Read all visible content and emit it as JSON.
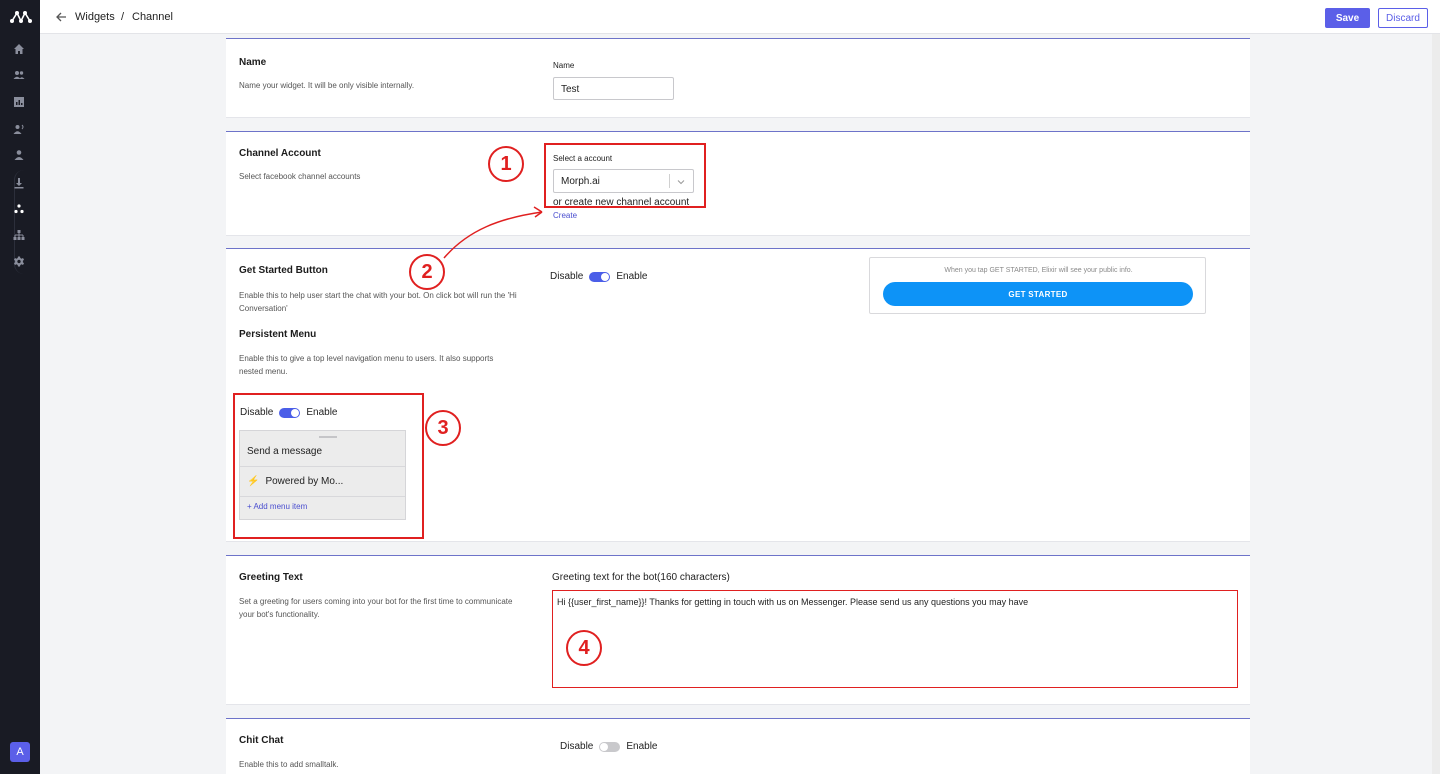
{
  "sidebar": {
    "logo": "morph-logo-icon",
    "items": [
      {
        "icon": "home-icon"
      },
      {
        "icon": "users-group-icon"
      },
      {
        "icon": "analytics-icon"
      },
      {
        "icon": "broadcast-user-icon"
      },
      {
        "icon": "user-icon"
      },
      {
        "icon": "download-icon"
      },
      {
        "icon": "widgets-icon",
        "active": true
      },
      {
        "icon": "hierarchy-icon"
      },
      {
        "icon": "settings-icon"
      }
    ],
    "avatar_initial": "A",
    "avatar_color": "#5b5fe8"
  },
  "topbar": {
    "breadcrumb": {
      "parent": "Widgets",
      "separator": "/",
      "current": "Channel"
    },
    "save_label": "Save",
    "discard_label": "Discard"
  },
  "colors": {
    "accent": "#5b5fe8",
    "annotation": "#e02020",
    "fb_blue": "#0d93f7"
  },
  "name_section": {
    "title": "Name",
    "description": "Name your widget. It will be only visible internally.",
    "field_label": "Name",
    "field_value": "Test"
  },
  "channel_section": {
    "title": "Channel Account",
    "description": "Select facebook channel accounts",
    "select_label": "Select a account",
    "selected_account": "Morph.ai",
    "create_prompt": "or create new channel account",
    "create_link": "Create"
  },
  "get_started_section": {
    "title": "Get Started Button",
    "description": "Enable this to help user start the chat with your bot. On click bot will run the 'Hi Conversation'",
    "toggle_off_label": "Disable",
    "toggle_on_label": "Enable",
    "enabled": true,
    "preview_note": "When you tap GET STARTED, Elixir will see your public info.",
    "preview_button": "GET STARTED"
  },
  "persistent_menu_section": {
    "title": "Persistent Menu",
    "description": "Enable this to give a top level navigation menu to users. It also supports nested menu.",
    "toggle_off_label": "Disable",
    "toggle_on_label": "Enable",
    "enabled": true,
    "items": [
      {
        "label": "Send a message"
      },
      {
        "label": "Powered by Mo...",
        "icon": "⚡"
      }
    ],
    "add_label": "+ Add menu item"
  },
  "greeting_section": {
    "title": "Greeting Text",
    "description": "Set a greeting for users coming into your bot for the first time to communicate your bot's functionality.",
    "field_label": "Greeting text for the bot(160 characters)",
    "value": "Hi {{user_first_name}}! Thanks for getting in touch with us on Messenger. Please send us any questions you  may  have"
  },
  "chitchat_section": {
    "title": "Chit Chat",
    "description": "Enable this to add smalltalk.",
    "toggle_off_label": "Disable",
    "toggle_on_label": "Enable",
    "enabled": false
  },
  "annotations": {
    "marker_1": "1",
    "marker_2": "2",
    "marker_3": "3",
    "marker_4": "4"
  }
}
